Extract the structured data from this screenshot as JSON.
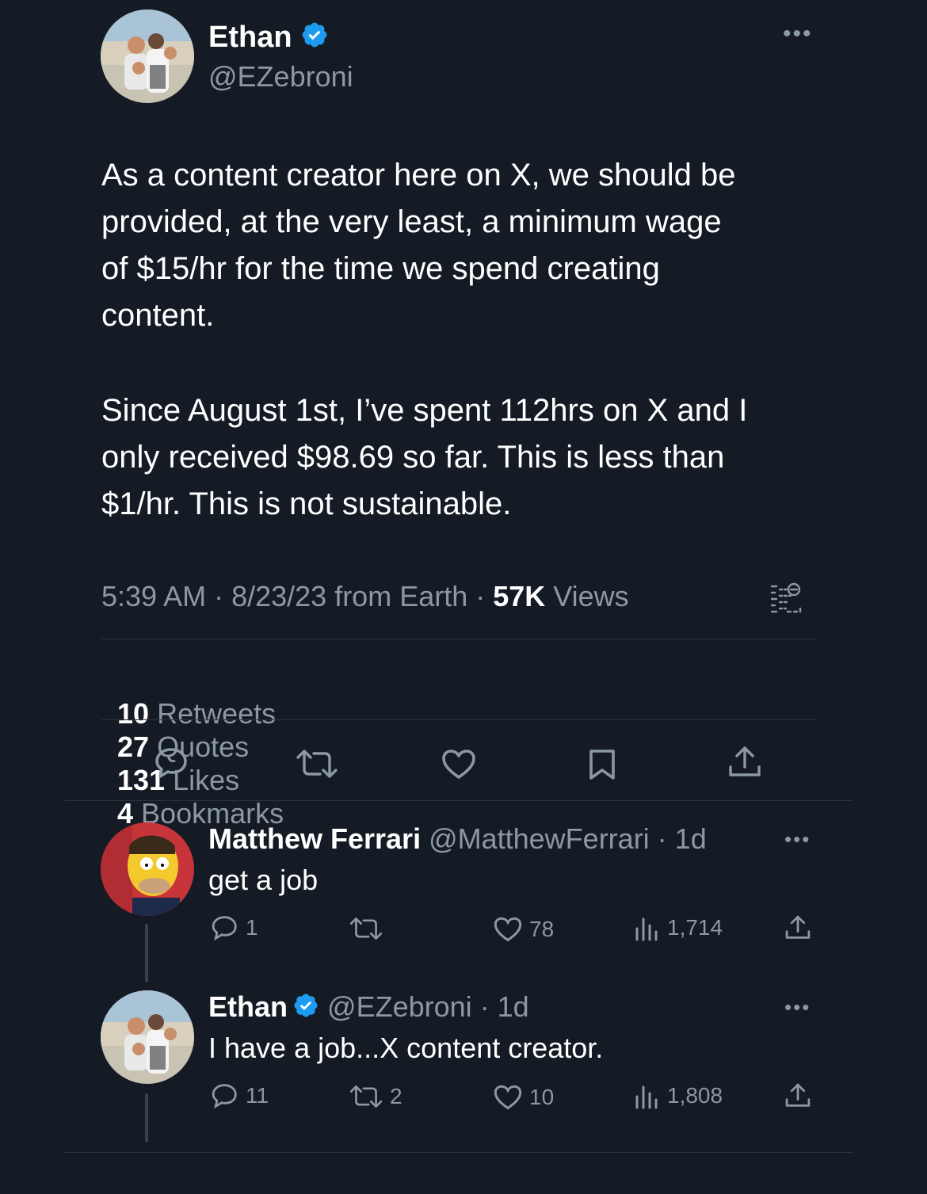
{
  "colors": {
    "background": "#151b24",
    "verified": "#1d9bf0",
    "muted": "#8b98a5"
  },
  "main_tweet": {
    "author_name": "Ethan",
    "author_handle": "@EZebroni",
    "more_icon": "more-horizontal-icon",
    "paragraph1": "As a content creator here on X, we should be\nprovided, at the very least, a minimum wage\nof $15/hr for the time we spend creating\ncontent.",
    "paragraph2": "Since August 1st, I’ve spent 112hrs on X and I\nonly received $98.69 so far. This is less than\n$1/hr. This is not sustainable.",
    "meta_time": "5:39 AM · 8/23/23 from Earth · ",
    "meta_views_count": "57K",
    "meta_views_label": " Views",
    "stats": [
      {
        "count": "10",
        "label": " Retweets"
      },
      {
        "count": "27",
        "label": " Quotes"
      },
      {
        "count": "131",
        "label": " Likes"
      },
      {
        "count": "4",
        "label": " Bookmarks"
      }
    ]
  },
  "replies": [
    {
      "name": "Matthew Ferrari",
      "handle_time": " @MatthewFerrari · 1d",
      "text": "get a job",
      "replies_count": "1",
      "retweets_count": "",
      "likes_count": "78",
      "views_count": "1,714"
    },
    {
      "name": "Ethan",
      "handle_time": " @EZebroni · 1d",
      "text": "I have a job...X content creator.",
      "replies_count": "11",
      "retweets_count": "2",
      "likes_count": "10",
      "views_count": "1,808"
    }
  ]
}
